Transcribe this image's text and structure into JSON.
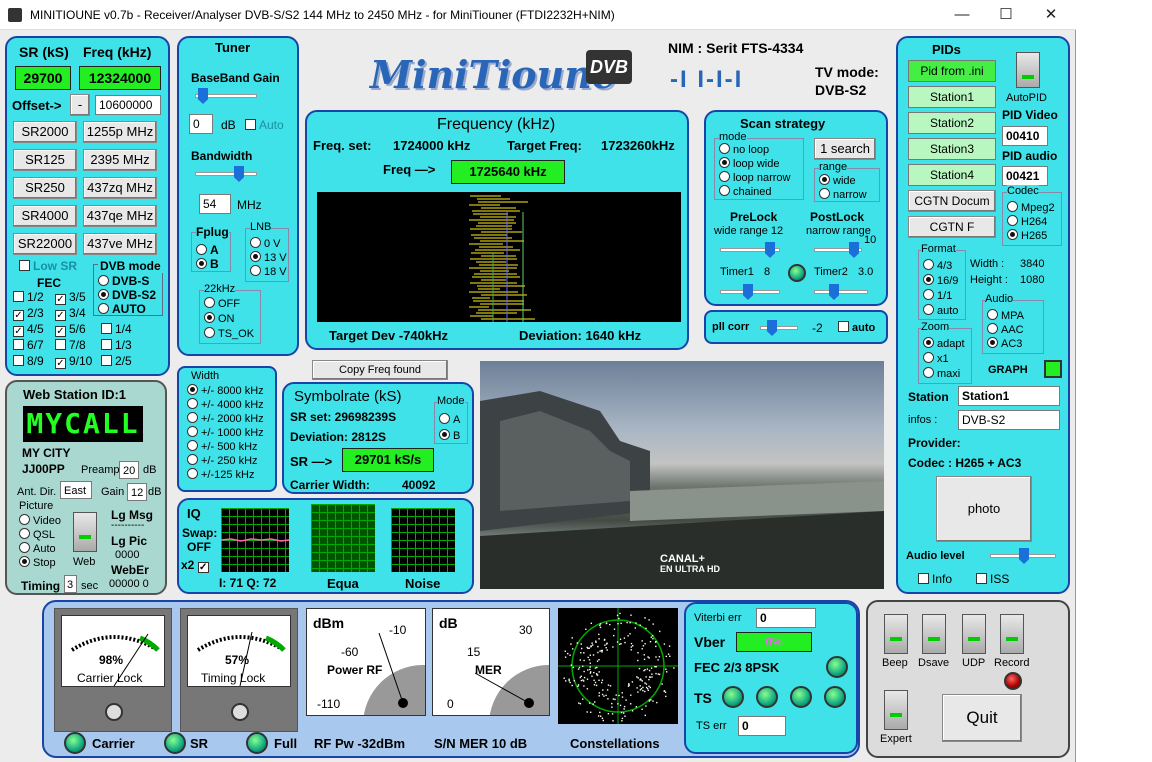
{
  "window": {
    "title": "MINITIOUNE v0.7b - Receiver/Analyser DVB-S/S2 144 MHz to 2450 MHz - for MiniTiouner (FTDI2232H+NIM)",
    "minimize": "—",
    "maximize": "☐",
    "close": "✕"
  },
  "logo": {
    "text": "MiniTioune",
    "badge": "DVB",
    "sub": "-I I-I-I"
  },
  "nim": {
    "label": "NIM : Serit FTS-4334",
    "tvmode_label": "TV mode:",
    "tvmode_value": "DVB-S2"
  },
  "sr": {
    "header_sr": "SR (kS)",
    "header_freq": "Freq (kHz)",
    "sr_value": "29700",
    "freq_value": "12324000",
    "offset_label": "Offset->",
    "offset_sign": "-",
    "offset_value": "10600000",
    "buttons": [
      [
        "SR2000",
        "1255p MHz"
      ],
      [
        "SR125",
        "2395 MHz"
      ],
      [
        "SR250",
        "437zq MHz"
      ],
      [
        "SR4000",
        "437qe MHz"
      ],
      [
        "SR22000",
        "437ve MHz"
      ]
    ],
    "low_sr": "Low SR",
    "fec_title": "FEC",
    "fec": [
      [
        "1/2",
        "3/5"
      ],
      [
        "2/3",
        "3/4"
      ],
      [
        "4/5",
        "5/6"
      ],
      [
        "6/7",
        "7/8"
      ],
      [
        "8/9",
        "9/10"
      ]
    ],
    "fec_checked": [
      [
        false,
        true
      ],
      [
        true,
        true
      ],
      [
        true,
        true
      ],
      [
        false,
        false
      ],
      [
        false,
        true
      ]
    ],
    "dvb_title": "DVB mode",
    "dvb": [
      "DVB-S",
      "DVB-S2",
      "AUTO"
    ],
    "extra_fec": [
      "1/4",
      "1/3",
      "2/5"
    ]
  },
  "tuner": {
    "title": "Tuner",
    "bb_gain": "BaseBand Gain",
    "gain_value": "0",
    "db": "dB",
    "auto": "Auto",
    "bandwidth": "Bandwidth",
    "bw_value": "54",
    "mhz": "MHz",
    "fplug": "Fplug",
    "fplug_opts": [
      "A",
      "B"
    ],
    "lnb": "LNB",
    "lnb_opts": [
      "0 V",
      "13 V",
      "18 V"
    ],
    "k22": "22kHz",
    "k22_opts": [
      "OFF",
      "ON",
      "TS_OK"
    ]
  },
  "freq": {
    "title": "Frequency (kHz)",
    "set_label": "Freq. set:",
    "set_value": "1724000 kHz",
    "target_label": "Target Freq:",
    "target_value": "1723260kHz",
    "freq_label": "Freq —>",
    "freq_value": "1725640 kHz",
    "target_dev": "Target Dev -740kHz",
    "deviation": "Deviation: 1640 kHz"
  },
  "scan": {
    "title": "Scan strategy",
    "mode": "mode",
    "modes": [
      "no loop",
      "loop wide",
      "loop narrow",
      "chained"
    ],
    "search_btn": "1 search",
    "range": "range",
    "ranges": [
      "wide",
      "narrow"
    ],
    "prelock": "PreLock",
    "prelock_sub": "wide range 12",
    "postlock": "PostLock",
    "postlock_sub": "narrow range",
    "postlock_val": "10",
    "timer1": "Timer1",
    "timer1_val": "8",
    "timer2": "Timer2",
    "timer2_val": "3.0"
  },
  "pll": {
    "label": "pll corr",
    "value": "-2",
    "auto": "auto"
  },
  "width": {
    "title": "Width",
    "opts": [
      "+/- 8000 kHz",
      "+/- 4000 kHz",
      "+/- 2000 kHz",
      "+/- 1000 kHz",
      "+/- 500 kHz",
      "+/- 250 kHz",
      "+/-125 kHz"
    ]
  },
  "copyfreq": "Copy Freq found",
  "symbol": {
    "title": "Symbolrate (kS)",
    "set": "SR set:  29698239S",
    "dev": "Deviation: 2812S",
    "sr_label": "SR —>",
    "sr_value": "29701 kS/s",
    "carrier": "Carrier Width:",
    "carrier_val": "40092",
    "mode": "Mode",
    "modes": [
      "A",
      "B"
    ]
  },
  "iq": {
    "title": "IQ",
    "swap": "Swap:",
    "swap_val": "OFF",
    "x2": "x2",
    "iq_vals": "I: 71 Q: 72",
    "equa": "Equa",
    "noise": "Noise"
  },
  "video": {
    "overlay1": "CANAL+",
    "overlay2": "EN ULTRA HD"
  },
  "web": {
    "title": "Web Station ID:1",
    "call": "MYCALL",
    "city": "MY CITY",
    "loc": "JJ00PP",
    "preamp": "Preamp",
    "preamp_val": "20",
    "db": "dB",
    "antdir": "Ant. Dir.",
    "antdir_val": "East",
    "gain": "Gain",
    "gain_val": "12",
    "picture": "Picture",
    "pics": [
      "Video",
      "QSL",
      "Auto",
      "Stop"
    ],
    "web": "Web",
    "lgmsg": "Lg Msg",
    "dashes": "----------",
    "lgpic": "Lg Pic",
    "lgpic_val": "0000",
    "weber": "WebEr",
    "weber_val": "00000  0",
    "timing": "Timing",
    "timing_val": "3",
    "sec": "sec"
  },
  "pids": {
    "title": "PIDs",
    "pidini": "Pid from .ini",
    "stations": [
      "Station1",
      "Station2",
      "Station3",
      "Station4"
    ],
    "cgtn1": "CGTN Docum",
    "cgtn2": "CGTN F",
    "autopid": "AutoPID",
    "pidvideo": "PID Video",
    "pidvideo_val": "00410",
    "pidaudio": "PID audio",
    "pidaudio_val": "00421",
    "codec": "Codec",
    "codecs": [
      "Mpeg2",
      "H264",
      "H265"
    ],
    "format": "Format",
    "formats": [
      "4/3",
      "16/9",
      "1/1",
      "auto"
    ],
    "width": "Width :",
    "width_val": "3840",
    "height": "Height :",
    "height_val": "1080",
    "audio": "Audio",
    "audios": [
      "MPA",
      "AAC",
      "AC3"
    ],
    "zoom": "Zoom",
    "zooms": [
      "adapt",
      "x1",
      "maxi"
    ],
    "graph": "GRAPH",
    "station": "Station",
    "station_val": "Station1",
    "infos": "infos :",
    "infos_val": "DVB-S2",
    "provider": "Provider:",
    "codec_line": "Codec :   H265 + AC3",
    "photo": "photo",
    "audio_level": "Audio level",
    "info": "Info",
    "iss": "ISS"
  },
  "bottom": {
    "carrier_lock_pct": "98%",
    "carrier_lock": "Carrier Lock",
    "timing_lock_pct": "57%",
    "timing_lock": "Timing Lock",
    "dbm": "dBm",
    "m10": "-10",
    "m60": "-60",
    "powerrf": "Power RF",
    "m110": "-110",
    "db": "dB",
    "d30": "30",
    "d15": "15",
    "mer": "MER",
    "d0": "0",
    "carrier": "Carrier",
    "sr": "SR",
    "full": "Full",
    "rfpw": "RF Pw -32dBm",
    "snmer": "S/N MER  10 dB",
    "constellations": "Constellations"
  },
  "status": {
    "viterbi": "Viterbi err",
    "viterbi_val": "0",
    "vber": "Vber",
    "vber_val": "0%",
    "fec": "FEC 2/3 8PSK",
    "ts": "TS",
    "tserr": "TS err",
    "tserr_val": "0"
  },
  "controls": {
    "beep": "Beep",
    "dsave": "Dsave",
    "udp": "UDP",
    "record": "Record",
    "expert": "Expert",
    "quit": "Quit"
  },
  "colors": {
    "panel": "#3fe2e8",
    "border": "#1844a8",
    "green": "#22ee22"
  }
}
